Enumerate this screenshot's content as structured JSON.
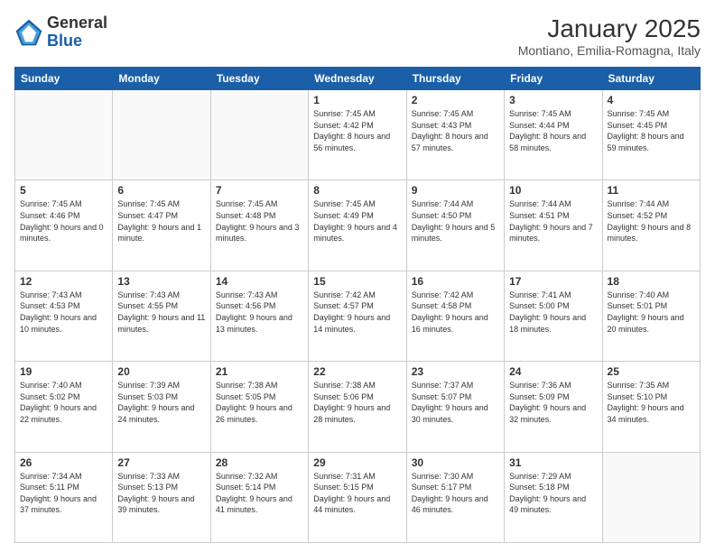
{
  "logo": {
    "general": "General",
    "blue": "Blue"
  },
  "header": {
    "title": "January 2025",
    "subtitle": "Montiano, Emilia-Romagna, Italy"
  },
  "weekdays": [
    "Sunday",
    "Monday",
    "Tuesday",
    "Wednesday",
    "Thursday",
    "Friday",
    "Saturday"
  ],
  "weeks": [
    [
      {
        "day": "",
        "info": ""
      },
      {
        "day": "",
        "info": ""
      },
      {
        "day": "",
        "info": ""
      },
      {
        "day": "1",
        "info": "Sunrise: 7:45 AM\nSunset: 4:42 PM\nDaylight: 8 hours\nand 56 minutes."
      },
      {
        "day": "2",
        "info": "Sunrise: 7:45 AM\nSunset: 4:43 PM\nDaylight: 8 hours\nand 57 minutes."
      },
      {
        "day": "3",
        "info": "Sunrise: 7:45 AM\nSunset: 4:44 PM\nDaylight: 8 hours\nand 58 minutes."
      },
      {
        "day": "4",
        "info": "Sunrise: 7:45 AM\nSunset: 4:45 PM\nDaylight: 8 hours\nand 59 minutes."
      }
    ],
    [
      {
        "day": "5",
        "info": "Sunrise: 7:45 AM\nSunset: 4:46 PM\nDaylight: 9 hours\nand 0 minutes."
      },
      {
        "day": "6",
        "info": "Sunrise: 7:45 AM\nSunset: 4:47 PM\nDaylight: 9 hours\nand 1 minute."
      },
      {
        "day": "7",
        "info": "Sunrise: 7:45 AM\nSunset: 4:48 PM\nDaylight: 9 hours\nand 3 minutes."
      },
      {
        "day": "8",
        "info": "Sunrise: 7:45 AM\nSunset: 4:49 PM\nDaylight: 9 hours\nand 4 minutes."
      },
      {
        "day": "9",
        "info": "Sunrise: 7:44 AM\nSunset: 4:50 PM\nDaylight: 9 hours\nand 5 minutes."
      },
      {
        "day": "10",
        "info": "Sunrise: 7:44 AM\nSunset: 4:51 PM\nDaylight: 9 hours\nand 7 minutes."
      },
      {
        "day": "11",
        "info": "Sunrise: 7:44 AM\nSunset: 4:52 PM\nDaylight: 9 hours\nand 8 minutes."
      }
    ],
    [
      {
        "day": "12",
        "info": "Sunrise: 7:43 AM\nSunset: 4:53 PM\nDaylight: 9 hours\nand 10 minutes."
      },
      {
        "day": "13",
        "info": "Sunrise: 7:43 AM\nSunset: 4:55 PM\nDaylight: 9 hours\nand 11 minutes."
      },
      {
        "day": "14",
        "info": "Sunrise: 7:43 AM\nSunset: 4:56 PM\nDaylight: 9 hours\nand 13 minutes."
      },
      {
        "day": "15",
        "info": "Sunrise: 7:42 AM\nSunset: 4:57 PM\nDaylight: 9 hours\nand 14 minutes."
      },
      {
        "day": "16",
        "info": "Sunrise: 7:42 AM\nSunset: 4:58 PM\nDaylight: 9 hours\nand 16 minutes."
      },
      {
        "day": "17",
        "info": "Sunrise: 7:41 AM\nSunset: 5:00 PM\nDaylight: 9 hours\nand 18 minutes."
      },
      {
        "day": "18",
        "info": "Sunrise: 7:40 AM\nSunset: 5:01 PM\nDaylight: 9 hours\nand 20 minutes."
      }
    ],
    [
      {
        "day": "19",
        "info": "Sunrise: 7:40 AM\nSunset: 5:02 PM\nDaylight: 9 hours\nand 22 minutes."
      },
      {
        "day": "20",
        "info": "Sunrise: 7:39 AM\nSunset: 5:03 PM\nDaylight: 9 hours\nand 24 minutes."
      },
      {
        "day": "21",
        "info": "Sunrise: 7:38 AM\nSunset: 5:05 PM\nDaylight: 9 hours\nand 26 minutes."
      },
      {
        "day": "22",
        "info": "Sunrise: 7:38 AM\nSunset: 5:06 PM\nDaylight: 9 hours\nand 28 minutes."
      },
      {
        "day": "23",
        "info": "Sunrise: 7:37 AM\nSunset: 5:07 PM\nDaylight: 9 hours\nand 30 minutes."
      },
      {
        "day": "24",
        "info": "Sunrise: 7:36 AM\nSunset: 5:09 PM\nDaylight: 9 hours\nand 32 minutes."
      },
      {
        "day": "25",
        "info": "Sunrise: 7:35 AM\nSunset: 5:10 PM\nDaylight: 9 hours\nand 34 minutes."
      }
    ],
    [
      {
        "day": "26",
        "info": "Sunrise: 7:34 AM\nSunset: 5:11 PM\nDaylight: 9 hours\nand 37 minutes."
      },
      {
        "day": "27",
        "info": "Sunrise: 7:33 AM\nSunset: 5:13 PM\nDaylight: 9 hours\nand 39 minutes."
      },
      {
        "day": "28",
        "info": "Sunrise: 7:32 AM\nSunset: 5:14 PM\nDaylight: 9 hours\nand 41 minutes."
      },
      {
        "day": "29",
        "info": "Sunrise: 7:31 AM\nSunset: 5:15 PM\nDaylight: 9 hours\nand 44 minutes."
      },
      {
        "day": "30",
        "info": "Sunrise: 7:30 AM\nSunset: 5:17 PM\nDaylight: 9 hours\nand 46 minutes."
      },
      {
        "day": "31",
        "info": "Sunrise: 7:29 AM\nSunset: 5:18 PM\nDaylight: 9 hours\nand 49 minutes."
      },
      {
        "day": "",
        "info": ""
      }
    ]
  ]
}
